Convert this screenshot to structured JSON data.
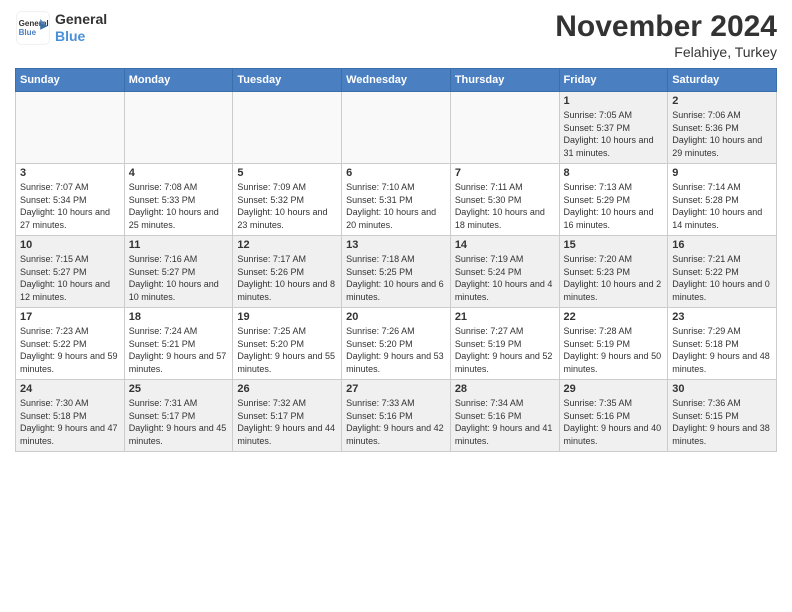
{
  "header": {
    "logo_line1": "General",
    "logo_line2": "Blue",
    "month": "November 2024",
    "location": "Felahiye, Turkey"
  },
  "days_of_week": [
    "Sunday",
    "Monday",
    "Tuesday",
    "Wednesday",
    "Thursday",
    "Friday",
    "Saturday"
  ],
  "weeks": [
    [
      {
        "day": "",
        "empty": true
      },
      {
        "day": "",
        "empty": true
      },
      {
        "day": "",
        "empty": true
      },
      {
        "day": "",
        "empty": true
      },
      {
        "day": "",
        "empty": true
      },
      {
        "day": "1",
        "sunrise": "7:05 AM",
        "sunset": "5:37 PM",
        "daylight": "10 hours and 31 minutes."
      },
      {
        "day": "2",
        "sunrise": "7:06 AM",
        "sunset": "5:36 PM",
        "daylight": "10 hours and 29 minutes."
      }
    ],
    [
      {
        "day": "3",
        "sunrise": "7:07 AM",
        "sunset": "5:34 PM",
        "daylight": "10 hours and 27 minutes."
      },
      {
        "day": "4",
        "sunrise": "7:08 AM",
        "sunset": "5:33 PM",
        "daylight": "10 hours and 25 minutes."
      },
      {
        "day": "5",
        "sunrise": "7:09 AM",
        "sunset": "5:32 PM",
        "daylight": "10 hours and 23 minutes."
      },
      {
        "day": "6",
        "sunrise": "7:10 AM",
        "sunset": "5:31 PM",
        "daylight": "10 hours and 20 minutes."
      },
      {
        "day": "7",
        "sunrise": "7:11 AM",
        "sunset": "5:30 PM",
        "daylight": "10 hours and 18 minutes."
      },
      {
        "day": "8",
        "sunrise": "7:13 AM",
        "sunset": "5:29 PM",
        "daylight": "10 hours and 16 minutes."
      },
      {
        "day": "9",
        "sunrise": "7:14 AM",
        "sunset": "5:28 PM",
        "daylight": "10 hours and 14 minutes."
      }
    ],
    [
      {
        "day": "10",
        "sunrise": "7:15 AM",
        "sunset": "5:27 PM",
        "daylight": "10 hours and 12 minutes."
      },
      {
        "day": "11",
        "sunrise": "7:16 AM",
        "sunset": "5:27 PM",
        "daylight": "10 hours and 10 minutes."
      },
      {
        "day": "12",
        "sunrise": "7:17 AM",
        "sunset": "5:26 PM",
        "daylight": "10 hours and 8 minutes."
      },
      {
        "day": "13",
        "sunrise": "7:18 AM",
        "sunset": "5:25 PM",
        "daylight": "10 hours and 6 minutes."
      },
      {
        "day": "14",
        "sunrise": "7:19 AM",
        "sunset": "5:24 PM",
        "daylight": "10 hours and 4 minutes."
      },
      {
        "day": "15",
        "sunrise": "7:20 AM",
        "sunset": "5:23 PM",
        "daylight": "10 hours and 2 minutes."
      },
      {
        "day": "16",
        "sunrise": "7:21 AM",
        "sunset": "5:22 PM",
        "daylight": "10 hours and 0 minutes."
      }
    ],
    [
      {
        "day": "17",
        "sunrise": "7:23 AM",
        "sunset": "5:22 PM",
        "daylight": "9 hours and 59 minutes."
      },
      {
        "day": "18",
        "sunrise": "7:24 AM",
        "sunset": "5:21 PM",
        "daylight": "9 hours and 57 minutes."
      },
      {
        "day": "19",
        "sunrise": "7:25 AM",
        "sunset": "5:20 PM",
        "daylight": "9 hours and 55 minutes."
      },
      {
        "day": "20",
        "sunrise": "7:26 AM",
        "sunset": "5:20 PM",
        "daylight": "9 hours and 53 minutes."
      },
      {
        "day": "21",
        "sunrise": "7:27 AM",
        "sunset": "5:19 PM",
        "daylight": "9 hours and 52 minutes."
      },
      {
        "day": "22",
        "sunrise": "7:28 AM",
        "sunset": "5:19 PM",
        "daylight": "9 hours and 50 minutes."
      },
      {
        "day": "23",
        "sunrise": "7:29 AM",
        "sunset": "5:18 PM",
        "daylight": "9 hours and 48 minutes."
      }
    ],
    [
      {
        "day": "24",
        "sunrise": "7:30 AM",
        "sunset": "5:18 PM",
        "daylight": "9 hours and 47 minutes."
      },
      {
        "day": "25",
        "sunrise": "7:31 AM",
        "sunset": "5:17 PM",
        "daylight": "9 hours and 45 minutes."
      },
      {
        "day": "26",
        "sunrise": "7:32 AM",
        "sunset": "5:17 PM",
        "daylight": "9 hours and 44 minutes."
      },
      {
        "day": "27",
        "sunrise": "7:33 AM",
        "sunset": "5:16 PM",
        "daylight": "9 hours and 42 minutes."
      },
      {
        "day": "28",
        "sunrise": "7:34 AM",
        "sunset": "5:16 PM",
        "daylight": "9 hours and 41 minutes."
      },
      {
        "day": "29",
        "sunrise": "7:35 AM",
        "sunset": "5:16 PM",
        "daylight": "9 hours and 40 minutes."
      },
      {
        "day": "30",
        "sunrise": "7:36 AM",
        "sunset": "5:15 PM",
        "daylight": "9 hours and 38 minutes."
      }
    ]
  ]
}
